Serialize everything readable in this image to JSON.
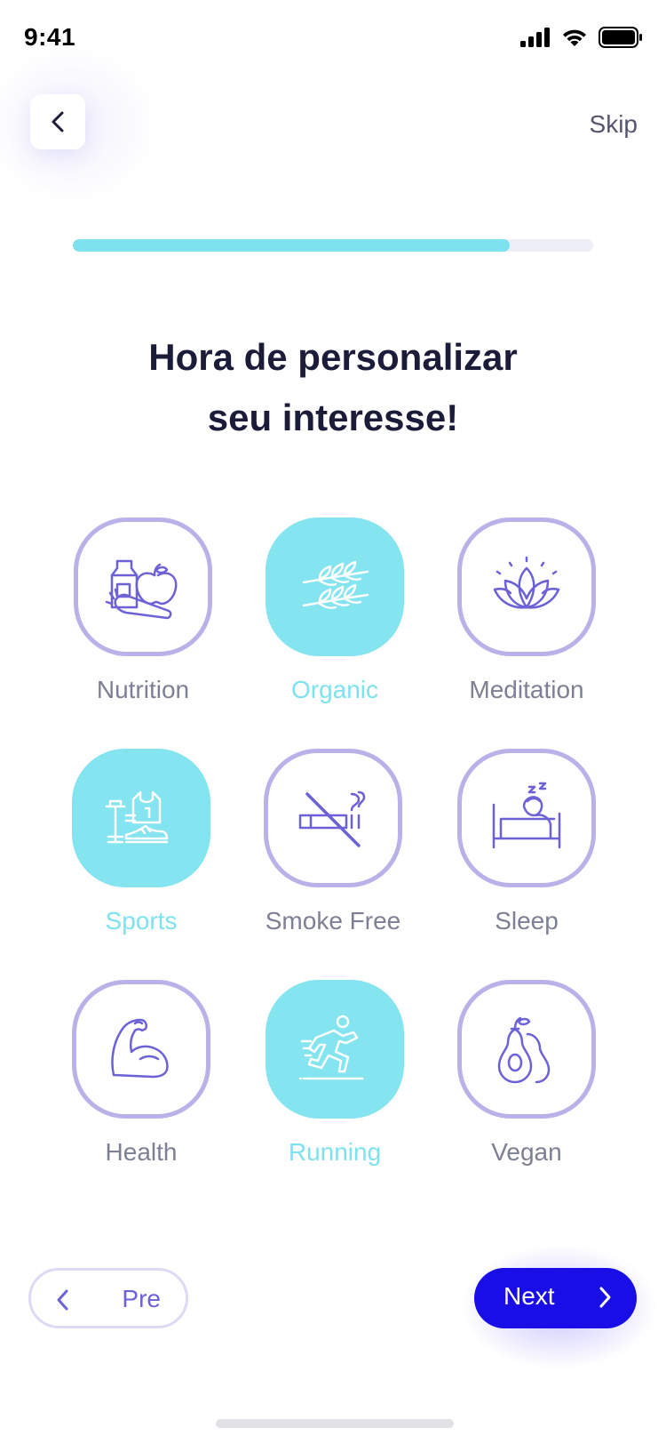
{
  "status_bar": {
    "time": "9:41"
  },
  "nav": {
    "skip_label": "Skip"
  },
  "progress": {
    "percent": 84
  },
  "title": {
    "line1": "Hora de personalizar",
    "line2": "seu interesse!"
  },
  "interests": [
    {
      "label": "Nutrition",
      "icon": "nutrition-icon",
      "selected": false
    },
    {
      "label": "Organic",
      "icon": "wheat-icon",
      "selected": true
    },
    {
      "label": "Meditation",
      "icon": "lotus-icon",
      "selected": false
    },
    {
      "label": "Sports",
      "icon": "sports-gear-icon",
      "selected": true
    },
    {
      "label": "Smoke Free",
      "icon": "no-smoking-icon",
      "selected": false
    },
    {
      "label": "Sleep",
      "icon": "sleep-icon",
      "selected": false
    },
    {
      "label": "Health",
      "icon": "flexed-arm-icon",
      "selected": false
    },
    {
      "label": "Running",
      "icon": "runner-icon",
      "selected": true
    },
    {
      "label": "Vegan",
      "icon": "avocado-icon",
      "selected": false
    }
  ],
  "footer": {
    "pre_label": "Pre",
    "next_label": "Next"
  },
  "colors": {
    "accent": "#1a0ee6",
    "selected": "#84e4ef",
    "tile_border": "#b8b2e8",
    "icon_stroke": "#6c61d6"
  }
}
